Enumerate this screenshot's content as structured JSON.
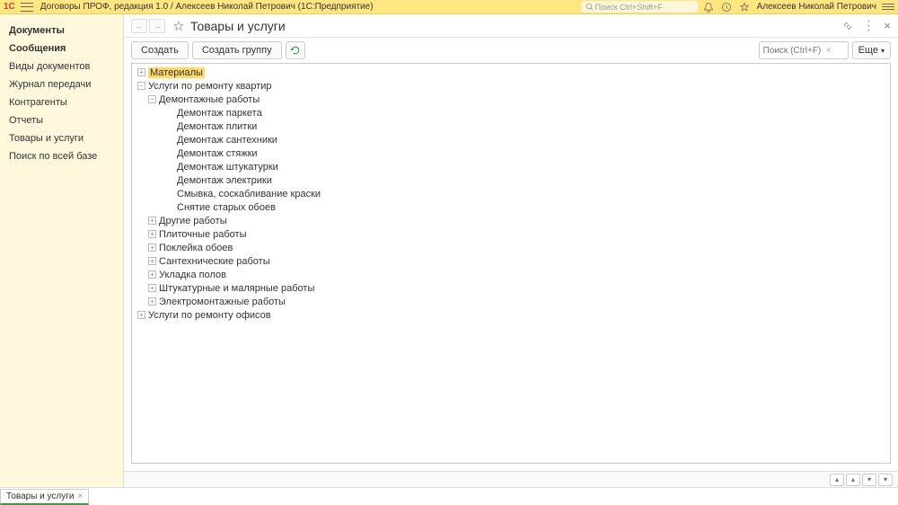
{
  "top": {
    "logo": "1C",
    "title": "Договоры ПРОФ, редакция 1.0 / Алексеев Николай Петрович  (1С:Предприятие)",
    "search_placeholder": "Поиск Ctrl+Shift+F",
    "username": "Алексеев Николай Петрович"
  },
  "sidebar": {
    "items": [
      {
        "label": "Документы",
        "bold": true
      },
      {
        "label": "Сообщения",
        "bold": true
      },
      {
        "label": "Виды документов",
        "bold": false
      },
      {
        "label": "Журнал передачи",
        "bold": false
      },
      {
        "label": "Контрагенты",
        "bold": false
      },
      {
        "label": "Отчеты",
        "bold": false
      },
      {
        "label": "Товары и услуги",
        "bold": false
      },
      {
        "label": "Поиск по всей базе",
        "bold": false
      }
    ]
  },
  "page": {
    "title": "Товары и услуги"
  },
  "toolbar": {
    "create": "Создать",
    "create_group": "Создать группу",
    "search_placeholder": "Поиск (Ctrl+F)",
    "more": "Еще"
  },
  "tree": [
    {
      "depth": 0,
      "expander": "closed",
      "label": "Материалы",
      "selected": true,
      "folder": true
    },
    {
      "depth": 0,
      "expander": "open",
      "label": "Услуги по ремонту квартир",
      "folder": true
    },
    {
      "depth": 1,
      "expander": "open",
      "label": "Демонтажные работы",
      "folder": true
    },
    {
      "depth": 2,
      "expander": "none",
      "label": "Демонтаж паркета"
    },
    {
      "depth": 2,
      "expander": "none",
      "label": "Демонтаж плитки"
    },
    {
      "depth": 2,
      "expander": "none",
      "label": "Демонтаж сантехники"
    },
    {
      "depth": 2,
      "expander": "none",
      "label": "Демонтаж стяжки"
    },
    {
      "depth": 2,
      "expander": "none",
      "label": "Демонтаж штукатурки"
    },
    {
      "depth": 2,
      "expander": "none",
      "label": "Демонтаж электрики"
    },
    {
      "depth": 2,
      "expander": "none",
      "label": "Смывка, соскабливание краски"
    },
    {
      "depth": 2,
      "expander": "none",
      "label": "Снятие старых обоев"
    },
    {
      "depth": 1,
      "expander": "closed",
      "label": "Другие работы",
      "folder": true
    },
    {
      "depth": 1,
      "expander": "closed",
      "label": "Плиточные работы",
      "folder": true
    },
    {
      "depth": 1,
      "expander": "closed",
      "label": "Поклейка обоев",
      "folder": true
    },
    {
      "depth": 1,
      "expander": "closed",
      "label": "Сантехнические работы",
      "folder": true
    },
    {
      "depth": 1,
      "expander": "closed",
      "label": "Укладка полов",
      "folder": true
    },
    {
      "depth": 1,
      "expander": "closed",
      "label": "Штукатурные и малярные работы",
      "folder": true
    },
    {
      "depth": 1,
      "expander": "closed",
      "label": "Электромонтажные работы",
      "folder": true
    },
    {
      "depth": 0,
      "expander": "closed",
      "label": "Услуги по ремонту офисов",
      "folder": true
    }
  ],
  "tab": {
    "label": "Товары и услуги"
  }
}
